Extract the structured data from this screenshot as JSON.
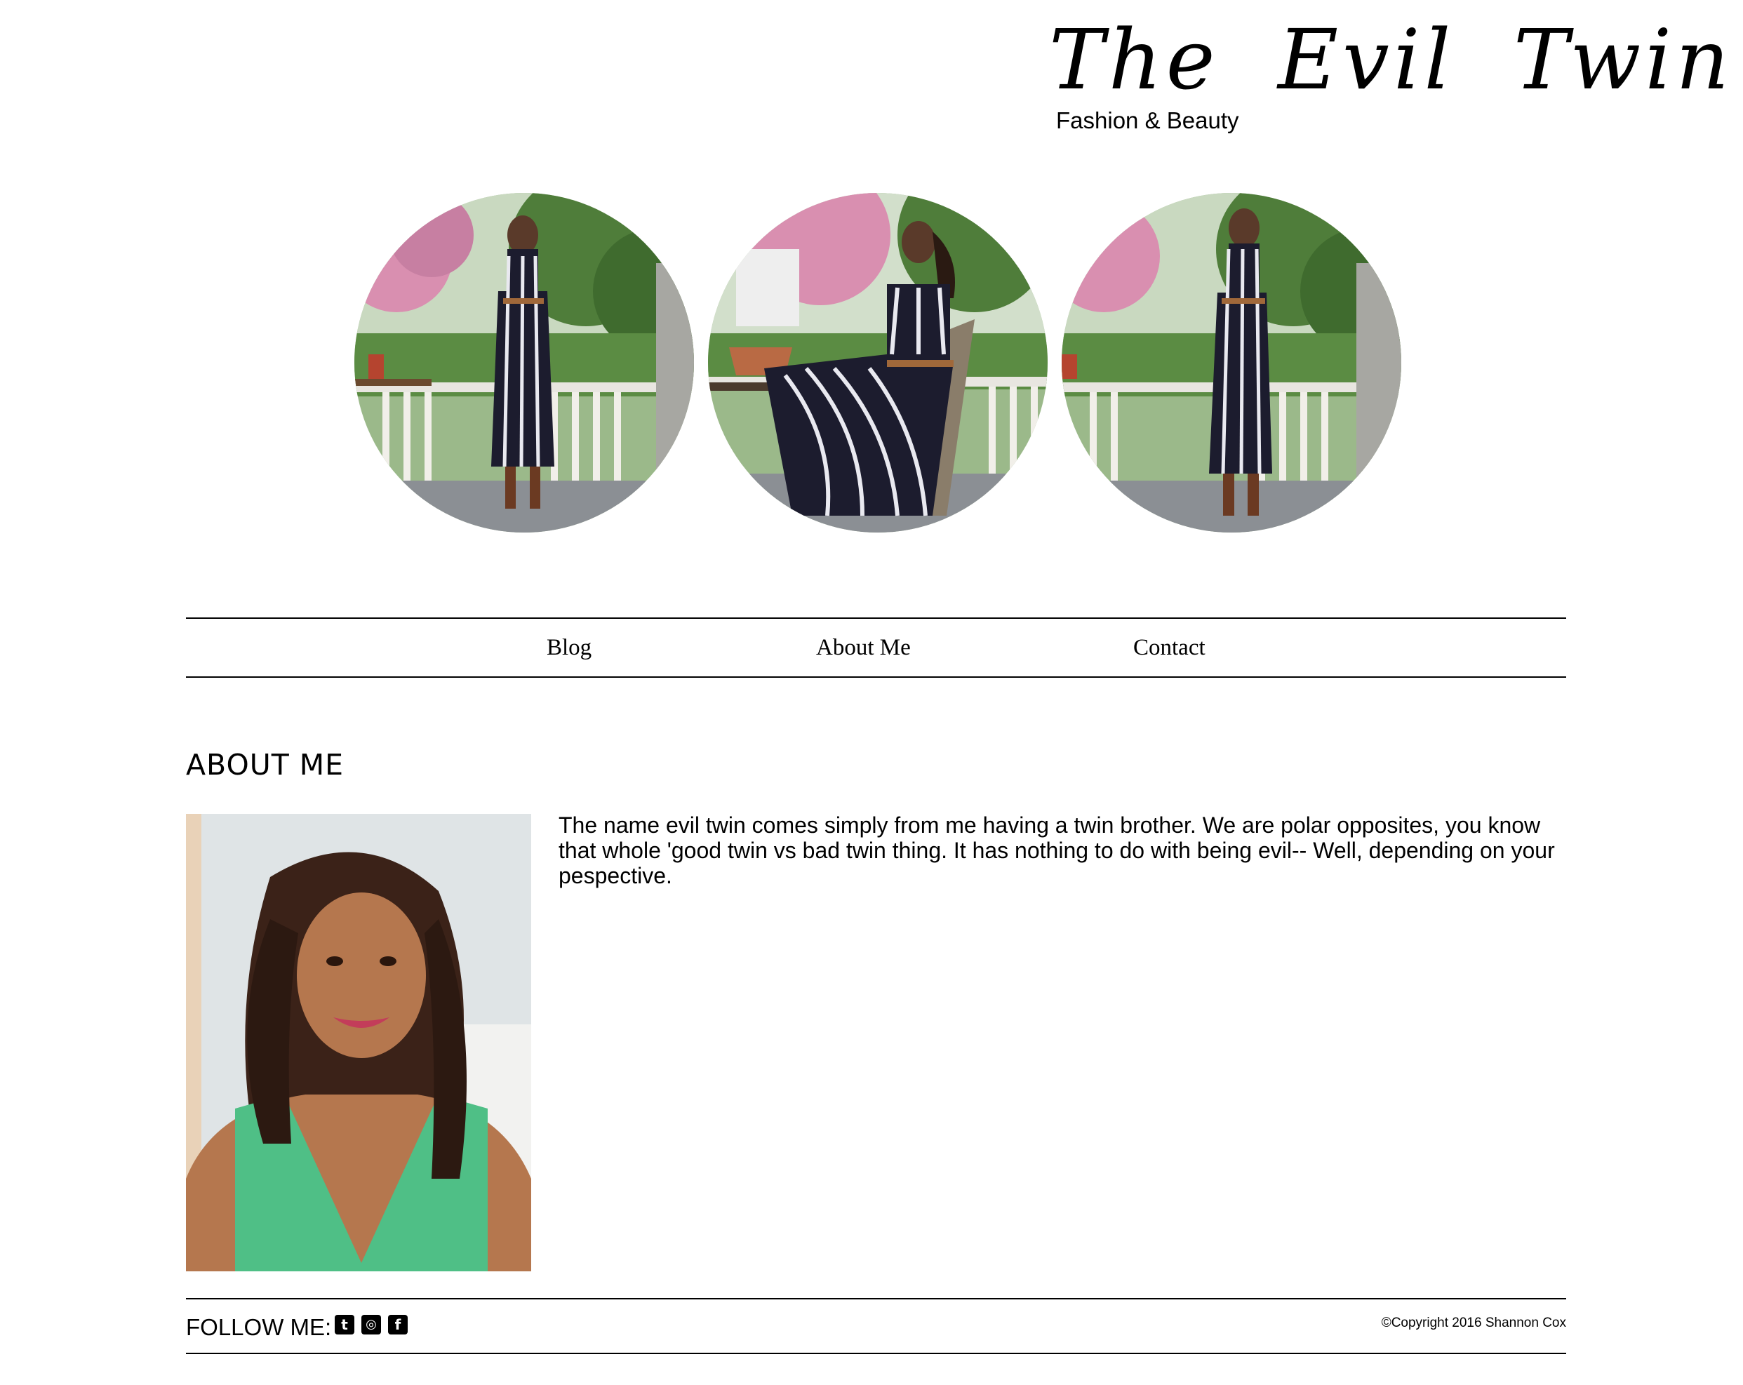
{
  "header": {
    "title": "The Evil Twin",
    "tagline": "Fashion & Beauty"
  },
  "nav": {
    "items": [
      {
        "label": "Blog"
      },
      {
        "label": "About Me"
      },
      {
        "label": "Contact"
      }
    ]
  },
  "main": {
    "heading": "ABOUT ME",
    "body": "The name evil twin comes simply from me having a twin brother. We are polar opposites, you know that whole 'good twin vs bad twin thing. It has nothing to do with being evil-- Well, depending on your pespective."
  },
  "footer": {
    "follow_label": "FOLLOW ME:",
    "social_icons": [
      "twitter-icon",
      "instagram-icon",
      "facebook-icon"
    ],
    "copyright": "©Copyright 2016 Shannon Cox"
  },
  "colors": {
    "background": "#ffffff",
    "text": "#000000",
    "dress": "#1c1c2e",
    "foliage": "#4f7d3a",
    "blossom": "#d98fb0"
  }
}
